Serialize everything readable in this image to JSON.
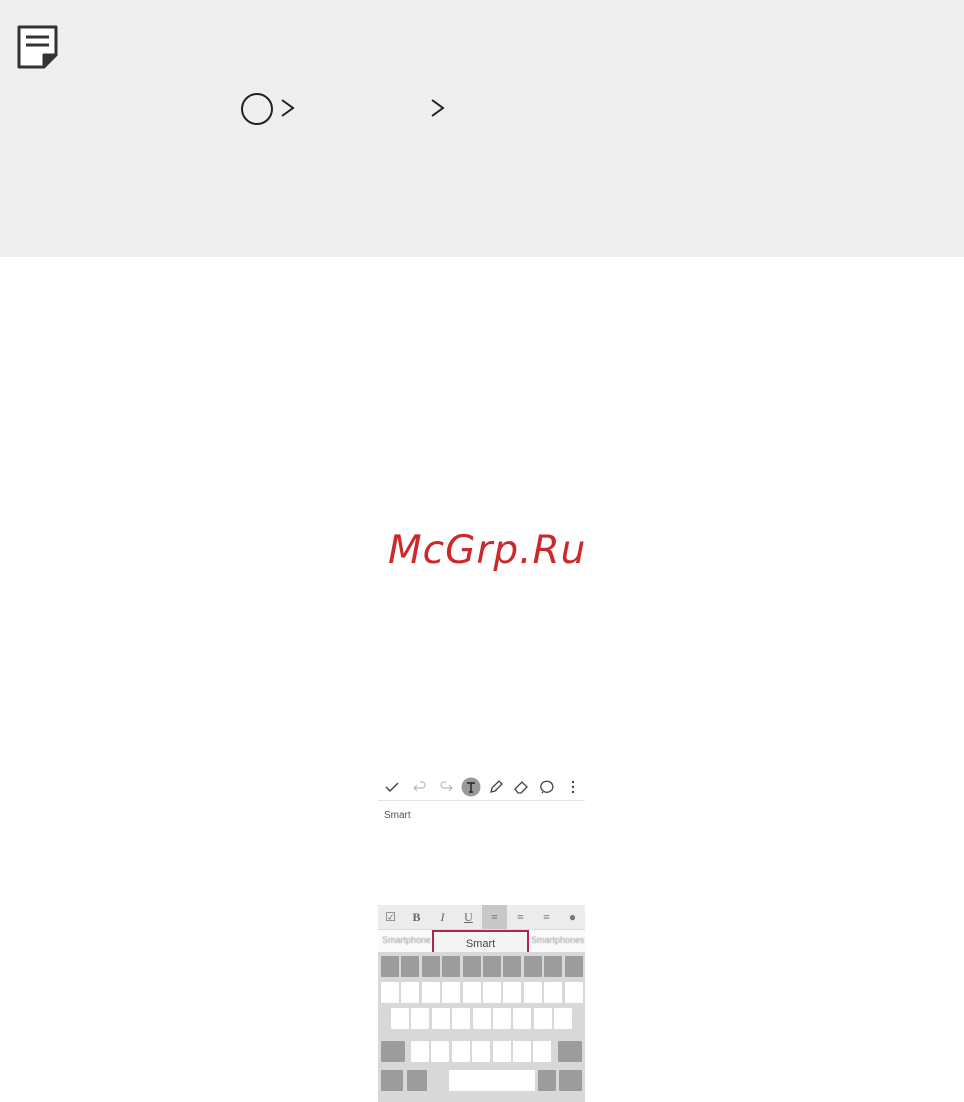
{
  "note_box": {
    "icons": [
      "note-icon",
      "home-circle-icon",
      "chevron-right-icon",
      "chevron-right-icon"
    ]
  },
  "watermark": "McGrp.Ru",
  "screenshot": {
    "toolbar_icons": [
      "check-icon",
      "undo-icon",
      "redo-icon",
      "text-mode-icon",
      "pen-icon",
      "eraser-icon",
      "lasso-icon",
      "more-icon"
    ],
    "note_text": "Smart",
    "format_bar": [
      "☑",
      "B",
      "I",
      "U",
      "≡",
      "≡",
      "≡",
      "●"
    ],
    "suggestions": {
      "left": "Smartphone",
      "main": "Smart",
      "right": "Smartphones"
    }
  }
}
